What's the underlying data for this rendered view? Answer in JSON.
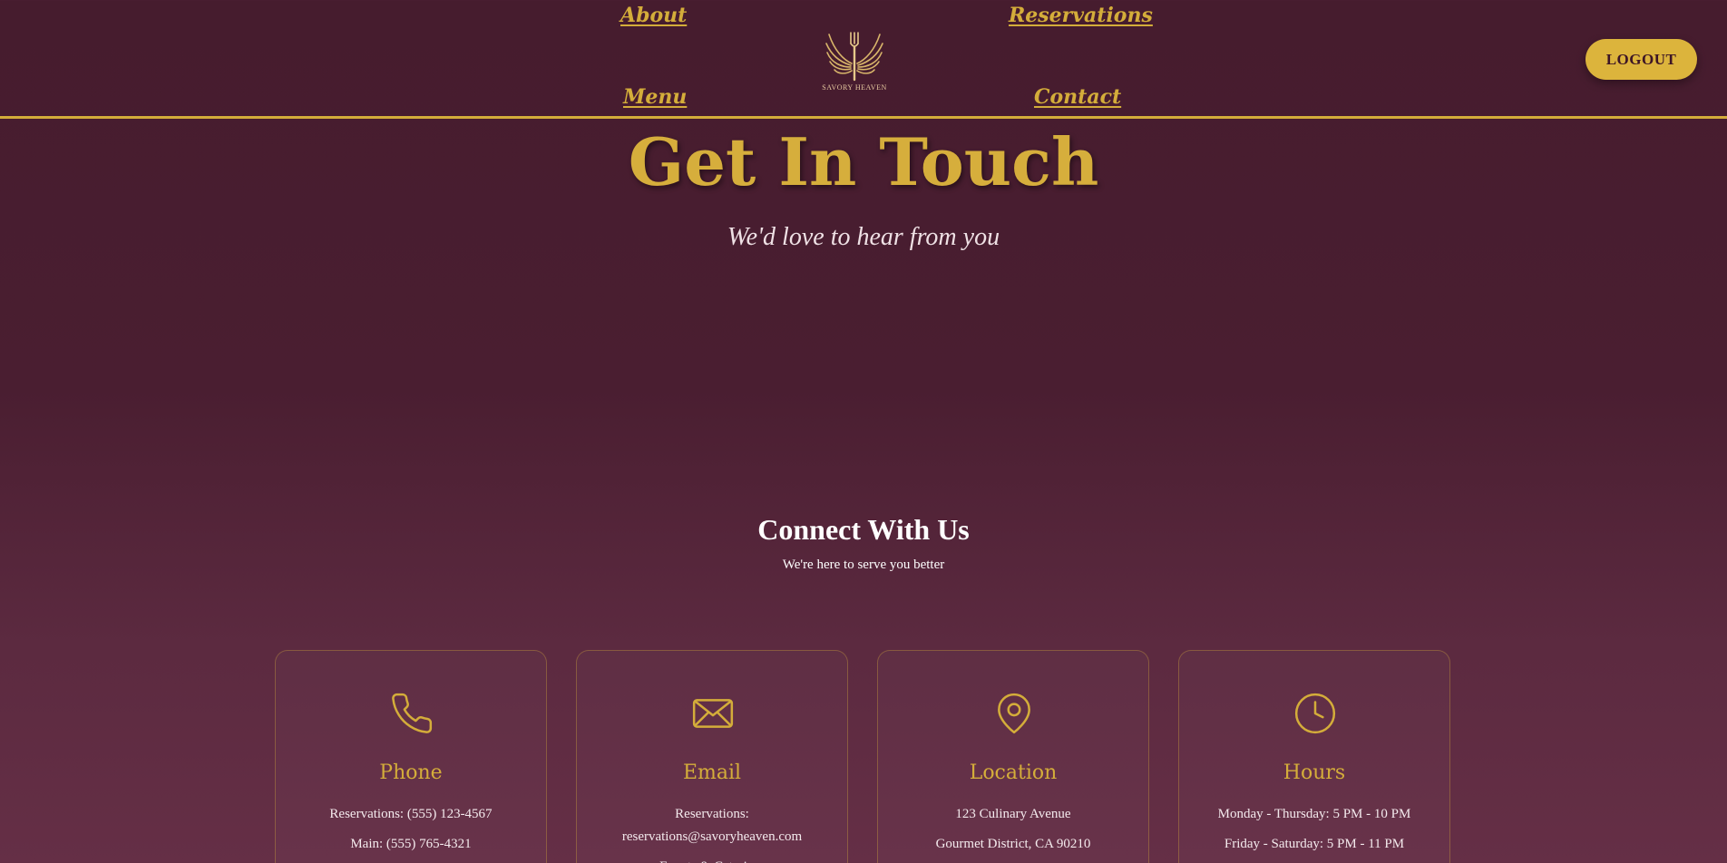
{
  "nav": {
    "about": "About",
    "reservations": "Reservations",
    "menu": "Menu",
    "contact": "Contact",
    "logo_text": "SAVORY HEAVEN",
    "logout": "LOGOUT"
  },
  "hero": {
    "title": "Get In Touch",
    "subtitle": "We'd love to hear from you"
  },
  "connect": {
    "title": "Connect With Us",
    "subtitle": "We're here to serve you better"
  },
  "cards": [
    {
      "icon": "phone-icon",
      "title": "Phone",
      "lines": [
        "Reservations: (555) 123-4567",
        "Main: (555) 765-4321"
      ]
    },
    {
      "icon": "email-icon",
      "title": "Email",
      "lines": [
        "Reservations:",
        "reservations@savoryheaven.com",
        "Events & Catering:"
      ]
    },
    {
      "icon": "location-pin-icon",
      "title": "Location",
      "lines": [
        "123 Culinary Avenue",
        "Gourmet District, CA 90210"
      ]
    },
    {
      "icon": "clock-icon",
      "title": "Hours",
      "lines": [
        "Monday - Thursday: 5 PM - 10 PM",
        "Friday - Saturday: 5 PM - 11 PM"
      ]
    }
  ],
  "colors": {
    "accent": "#d4ad3a",
    "background": "#4a1e31",
    "text": "#f3e6ea"
  }
}
